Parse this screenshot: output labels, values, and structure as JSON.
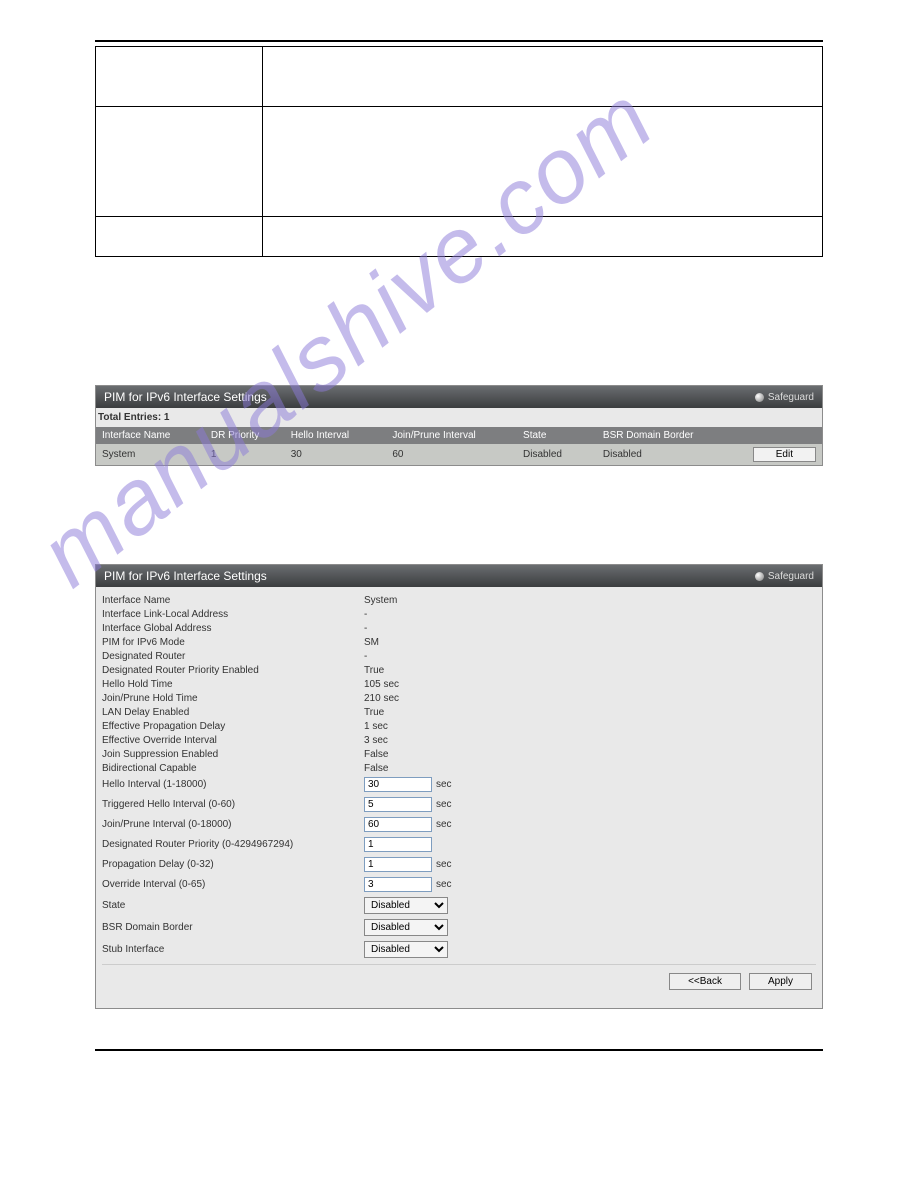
{
  "watermark_text": "manualshive.com",
  "panel1": {
    "title": "PIM for IPv6 Interface Settings",
    "safeguard": "Safeguard",
    "total_entries_label": "Total Entries: 1",
    "columns": [
      "Interface Name",
      "DR Priority",
      "Hello Interval",
      "Join/Prune Interval",
      "State",
      "BSR Domain Border",
      ""
    ],
    "row": {
      "iface": "System",
      "dr": "1",
      "hello": "30",
      "jp": "60",
      "state": "Disabled",
      "bsr": "Disabled",
      "edit_label": "Edit"
    }
  },
  "panel2": {
    "title": "PIM for IPv6 Interface Settings",
    "safeguard": "Safeguard",
    "rows_static": [
      {
        "label": "Interface Name",
        "value": "System"
      },
      {
        "label": "Interface Link-Local Address",
        "value": "-"
      },
      {
        "label": "Interface Global Address",
        "value": "-"
      },
      {
        "label": "PIM for IPv6 Mode",
        "value": "SM"
      },
      {
        "label": "Designated Router",
        "value": "-"
      },
      {
        "label": "Designated Router Priority Enabled",
        "value": "True"
      },
      {
        "label": "Hello Hold Time",
        "value": "105 sec"
      },
      {
        "label": "Join/Prune Hold Time",
        "value": "210 sec"
      },
      {
        "label": "LAN Delay Enabled",
        "value": "True"
      },
      {
        "label": "Effective Propagation Delay",
        "value": "1 sec"
      },
      {
        "label": "Effective Override Interval",
        "value": "3 sec"
      },
      {
        "label": "Join Suppression Enabled",
        "value": "False"
      },
      {
        "label": "Bidirectional Capable",
        "value": "False"
      }
    ],
    "inputs": [
      {
        "label": "Hello Interval (1-18000)",
        "value": "30",
        "unit": "sec",
        "key": "hello_interval"
      },
      {
        "label": "Triggered Hello Interval (0-60)",
        "value": "5",
        "unit": "sec",
        "key": "triggered_hello"
      },
      {
        "label": "Join/Prune Interval (0-18000)",
        "value": "60",
        "unit": "sec",
        "key": "join_prune"
      },
      {
        "label": "Designated Router Priority (0-4294967294)",
        "value": "1",
        "unit": "",
        "key": "dr_priority"
      },
      {
        "label": "Propagation Delay (0-32)",
        "value": "1",
        "unit": "sec",
        "key": "prop_delay"
      },
      {
        "label": "Override Interval (0-65)",
        "value": "3",
        "unit": "sec",
        "key": "override_interval"
      }
    ],
    "selects": [
      {
        "label": "State",
        "value": "Disabled",
        "key": "state"
      },
      {
        "label": "BSR Domain Border",
        "value": "Disabled",
        "key": "bsr_border"
      },
      {
        "label": "Stub Interface",
        "value": "Disabled",
        "key": "stub_iface"
      }
    ],
    "back_label": "<<Back",
    "apply_label": "Apply"
  }
}
